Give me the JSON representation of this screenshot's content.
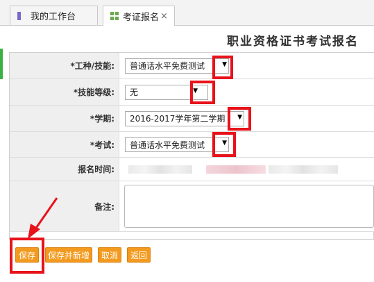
{
  "tabs": [
    {
      "label": "我的工作台"
    },
    {
      "label": "考证报名",
      "close": "×"
    }
  ],
  "page_title": "职业资格证书考试报名",
  "form": {
    "job_label": "*工种/技能:",
    "job_value": "普通话水平免费测试",
    "level_label": "*技能等级:",
    "level_value": "无",
    "term_label": "*学期:",
    "term_value": "2016-2017学年第二学期",
    "exam_label": "*考试:",
    "exam_value": "普通话水平免费测试",
    "time_label": "报名时间:",
    "remark_label": "备注:"
  },
  "dropdown_arrow": "▼",
  "buttons": {
    "save": "保存",
    "save_new": "保存并新增",
    "cancel": "取消",
    "back": "返回"
  },
  "colors": {
    "accent_orange": "#f39a1e",
    "annotation_red": "#e8121b"
  },
  "icons": [
    "tab-bar-icon",
    "grid-icon",
    "dropdown-arrow-icon",
    "annotation-arrow-icon"
  ]
}
